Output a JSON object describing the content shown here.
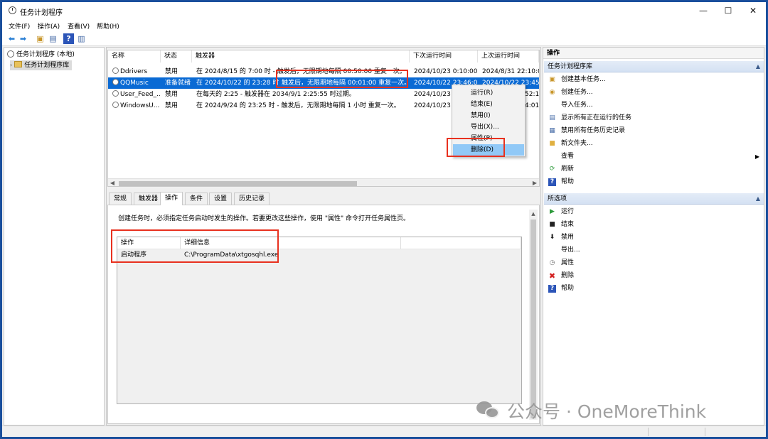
{
  "window": {
    "title": "任务计划程序",
    "controls": {
      "minimize": "—",
      "maximize": "☐",
      "close": "✕"
    }
  },
  "menu": [
    "文件(F)",
    "操作(A)",
    "查看(V)",
    "帮助(H)"
  ],
  "toolbar": [
    "back-icon",
    "forward-icon",
    "folder-up-icon",
    "console-tree-icon",
    "help-icon",
    "pane-icon"
  ],
  "tree": {
    "root": "任务计划程序 (本地)",
    "child": "任务计划程序库"
  },
  "tasklist": {
    "columns": [
      "名称",
      "状态",
      "触发器",
      "下次运行时间",
      "上次运行时间"
    ],
    "rows": [
      {
        "name": "Ddrivers",
        "status": "禁用",
        "trigger": "在 2024/8/15 的 7:00 时 - 触发后，无限期地每隔 00:50:00 重复一次。",
        "next": "2024/10/23 0:10:00",
        "last": "2024/8/31 22:10:00"
      },
      {
        "name": "QQMusic",
        "status": "准备就绪",
        "trigger": "在 2024/10/22 的 23:28 时",
        "trigger_tail": "触发后，无限期地每隔 00:01:00 重复一次。",
        "next": "2024/10/22 23:46:00",
        "last": "2024/10/22 23:45:00"
      },
      {
        "name": "User_Feed_...",
        "status": "禁用",
        "trigger": "在每天的 2:25 - 触发器在 2034/9/1 2:25:55 时过期。",
        "next": "2024/10/23",
        "last": "52:18"
      },
      {
        "name": "WindowsU...",
        "status": "禁用",
        "trigger": "在 2024/9/24 的 23:25 时 - 触发后，无限期地每隔 1 小时 重复一次。",
        "next": "2024/10/23",
        "last": "4:01"
      }
    ]
  },
  "context_menu": [
    "运行(R)",
    "结束(E)",
    "禁用(I)",
    "导出(X)...",
    "属性(P)",
    "删除(D)"
  ],
  "tabs": [
    "常规",
    "触发器",
    "操作",
    "条件",
    "设置",
    "历史记录"
  ],
  "actions_tab": {
    "description": "创建任务时，必须指定任务启动时发生的操作。若要更改这些操作，使用 \"属性\" 命令打开任务属性页。",
    "columns": [
      "操作",
      "详细信息"
    ],
    "row": {
      "action": "启动程序",
      "detail": "C:\\ProgramData\\xtgosqhl.exe"
    }
  },
  "right_pane": {
    "title": "操作",
    "section1": "任务计划程序库",
    "items1": [
      "创建基本任务...",
      "创建任务...",
      "导入任务...",
      "显示所有正在运行的任务",
      "禁用所有任务历史记录",
      "新文件夹...",
      "查看",
      "刷新",
      "帮助"
    ],
    "section2": "所选项",
    "items2": [
      "运行",
      "结束",
      "禁用",
      "导出...",
      "属性",
      "删除",
      "帮助"
    ]
  },
  "watermark": {
    "text": "公众号 · OneMoreThink"
  },
  "colors": {
    "selection": "#0a6ad4",
    "menu_highlight": "#91c9f7",
    "annotation_red": "#e8311f"
  }
}
